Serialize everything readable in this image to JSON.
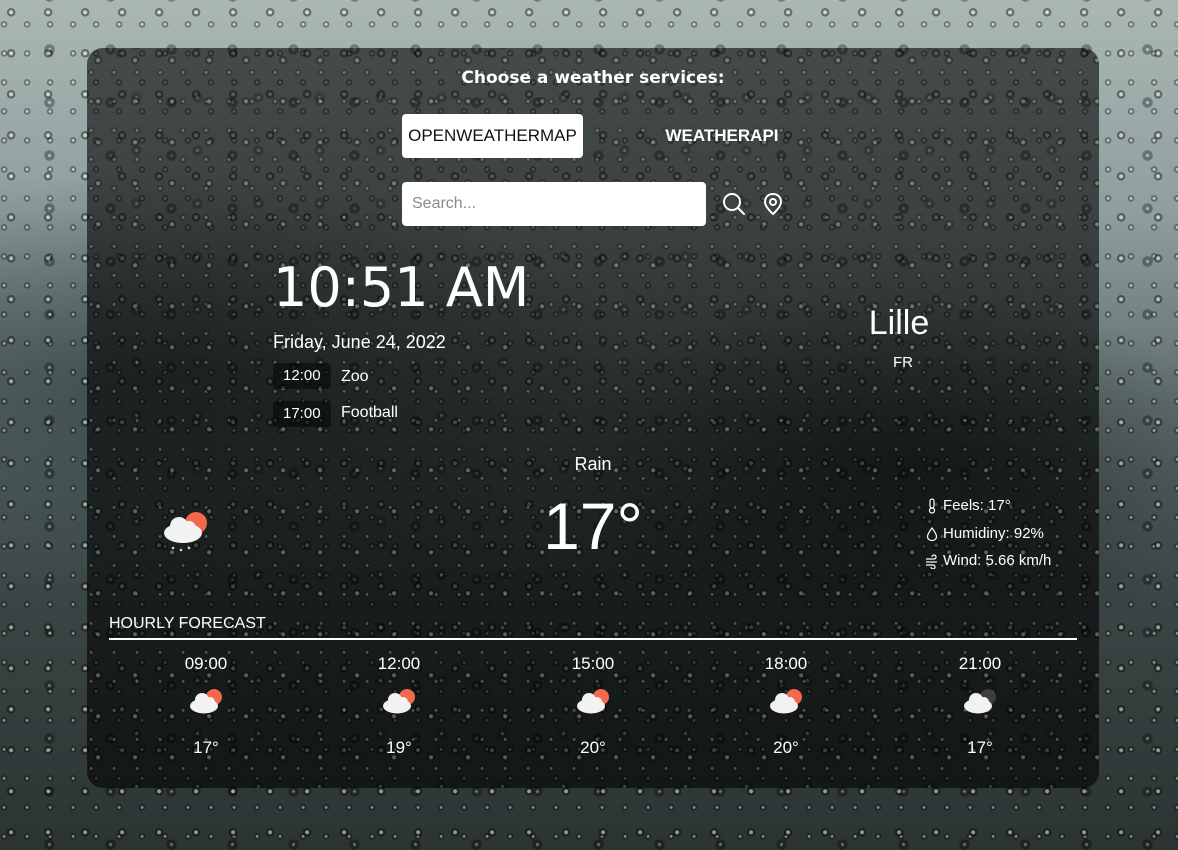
{
  "header": {
    "choose_label": "Choose a weather services:",
    "services": [
      {
        "label": "OPENWEATHERMAP",
        "active": true
      },
      {
        "label": "WEATHERAPI",
        "active": false
      }
    ]
  },
  "search": {
    "placeholder": "Search...",
    "value": "",
    "search_icon": "search-icon",
    "location_icon": "location-pin-icon"
  },
  "clock": {
    "time": "10:51 AM",
    "date": "Friday, June 24, 2022"
  },
  "events": [
    {
      "time": "12:00",
      "title": "Zoo"
    },
    {
      "time": "17:00",
      "title": "Football"
    }
  ],
  "location": {
    "city": "Lille",
    "country": "FR"
  },
  "current": {
    "condition": "Rain",
    "temperature": "17°",
    "icon": "cloud-sun-rain-icon",
    "details": [
      {
        "icon": "thermometer-icon",
        "text": "Feels: 17°"
      },
      {
        "icon": "humidity-icon",
        "text": "Humidiny: 92%"
      },
      {
        "icon": "wind-icon",
        "text": "Wind: 5.66 km/h"
      }
    ]
  },
  "hourly": {
    "title": "HOURLY FORECAST",
    "items": [
      {
        "time": "09:00",
        "temp": "17°",
        "icon": "cloud-sun-icon"
      },
      {
        "time": "12:00",
        "temp": "19°",
        "icon": "cloud-sun-icon"
      },
      {
        "time": "15:00",
        "temp": "20°",
        "icon": "cloud-sun-icon"
      },
      {
        "time": "18:00",
        "temp": "20°",
        "icon": "cloud-sun-icon"
      },
      {
        "time": "21:00",
        "temp": "17°",
        "icon": "cloud-moon-icon"
      }
    ]
  },
  "colors": {
    "sun": "#f26a4b",
    "cloud": "#f2f2f2",
    "panel_overlay": "rgba(0,0,0,0.58)"
  }
}
